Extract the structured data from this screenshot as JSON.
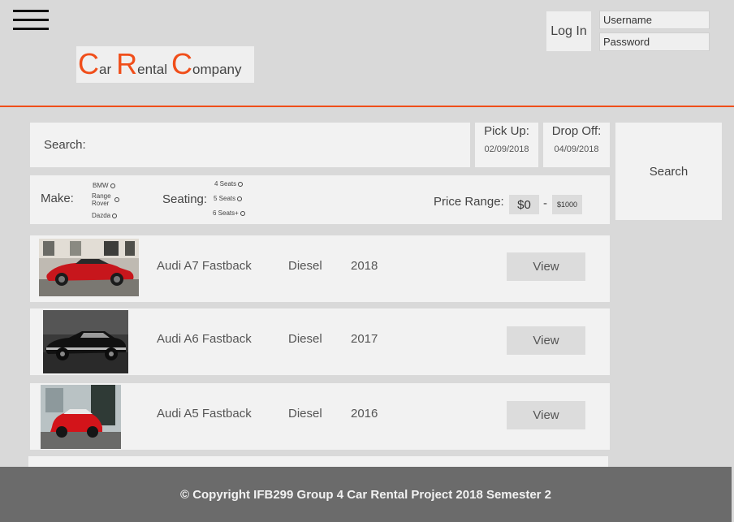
{
  "header": {
    "logo": [
      {
        "big": "C",
        "small": "ar"
      },
      {
        "big": "R",
        "small": "ental"
      },
      {
        "big": "C",
        "small": "ompany"
      }
    ],
    "login_label": "Log In",
    "username_placeholder": "Username",
    "password_placeholder": "Password"
  },
  "search": {
    "label": "Search:",
    "pickup_label": "Pick Up:",
    "pickup_date": "02/09/2018",
    "dropoff_label": "Drop Off:",
    "dropoff_date": "04/09/2018",
    "button_label": "Search"
  },
  "filters": {
    "make_label": "Make:",
    "make_options": [
      "BMW",
      "Range Rover",
      "Dazda"
    ],
    "seating_label": "Seating:",
    "seating_options": [
      "4 Seats",
      "5 Seats",
      "6 Seats+"
    ],
    "price_label": "Price Range:",
    "price_min": "$0",
    "price_dash": "-",
    "price_max": "$1000"
  },
  "cars": [
    {
      "name": "Audi A7 Fastback",
      "fuel": "Diesel",
      "year": "2018",
      "view_label": "View"
    },
    {
      "name": "Audi A6 Fastback",
      "fuel": "Diesel",
      "year": "2017",
      "view_label": "View"
    },
    {
      "name": "Audi A5 Fastback",
      "fuel": "Diesel",
      "year": "2016",
      "view_label": "View"
    }
  ],
  "colors": {
    "accent": "#f04e1a",
    "panel": "#f2f2f2",
    "background": "#d9d9d9",
    "footer": "#6b6b6b"
  },
  "footer": {
    "text": "© Copyright IFB299 Group 4 Car Rental Project 2018 Semester 2"
  }
}
